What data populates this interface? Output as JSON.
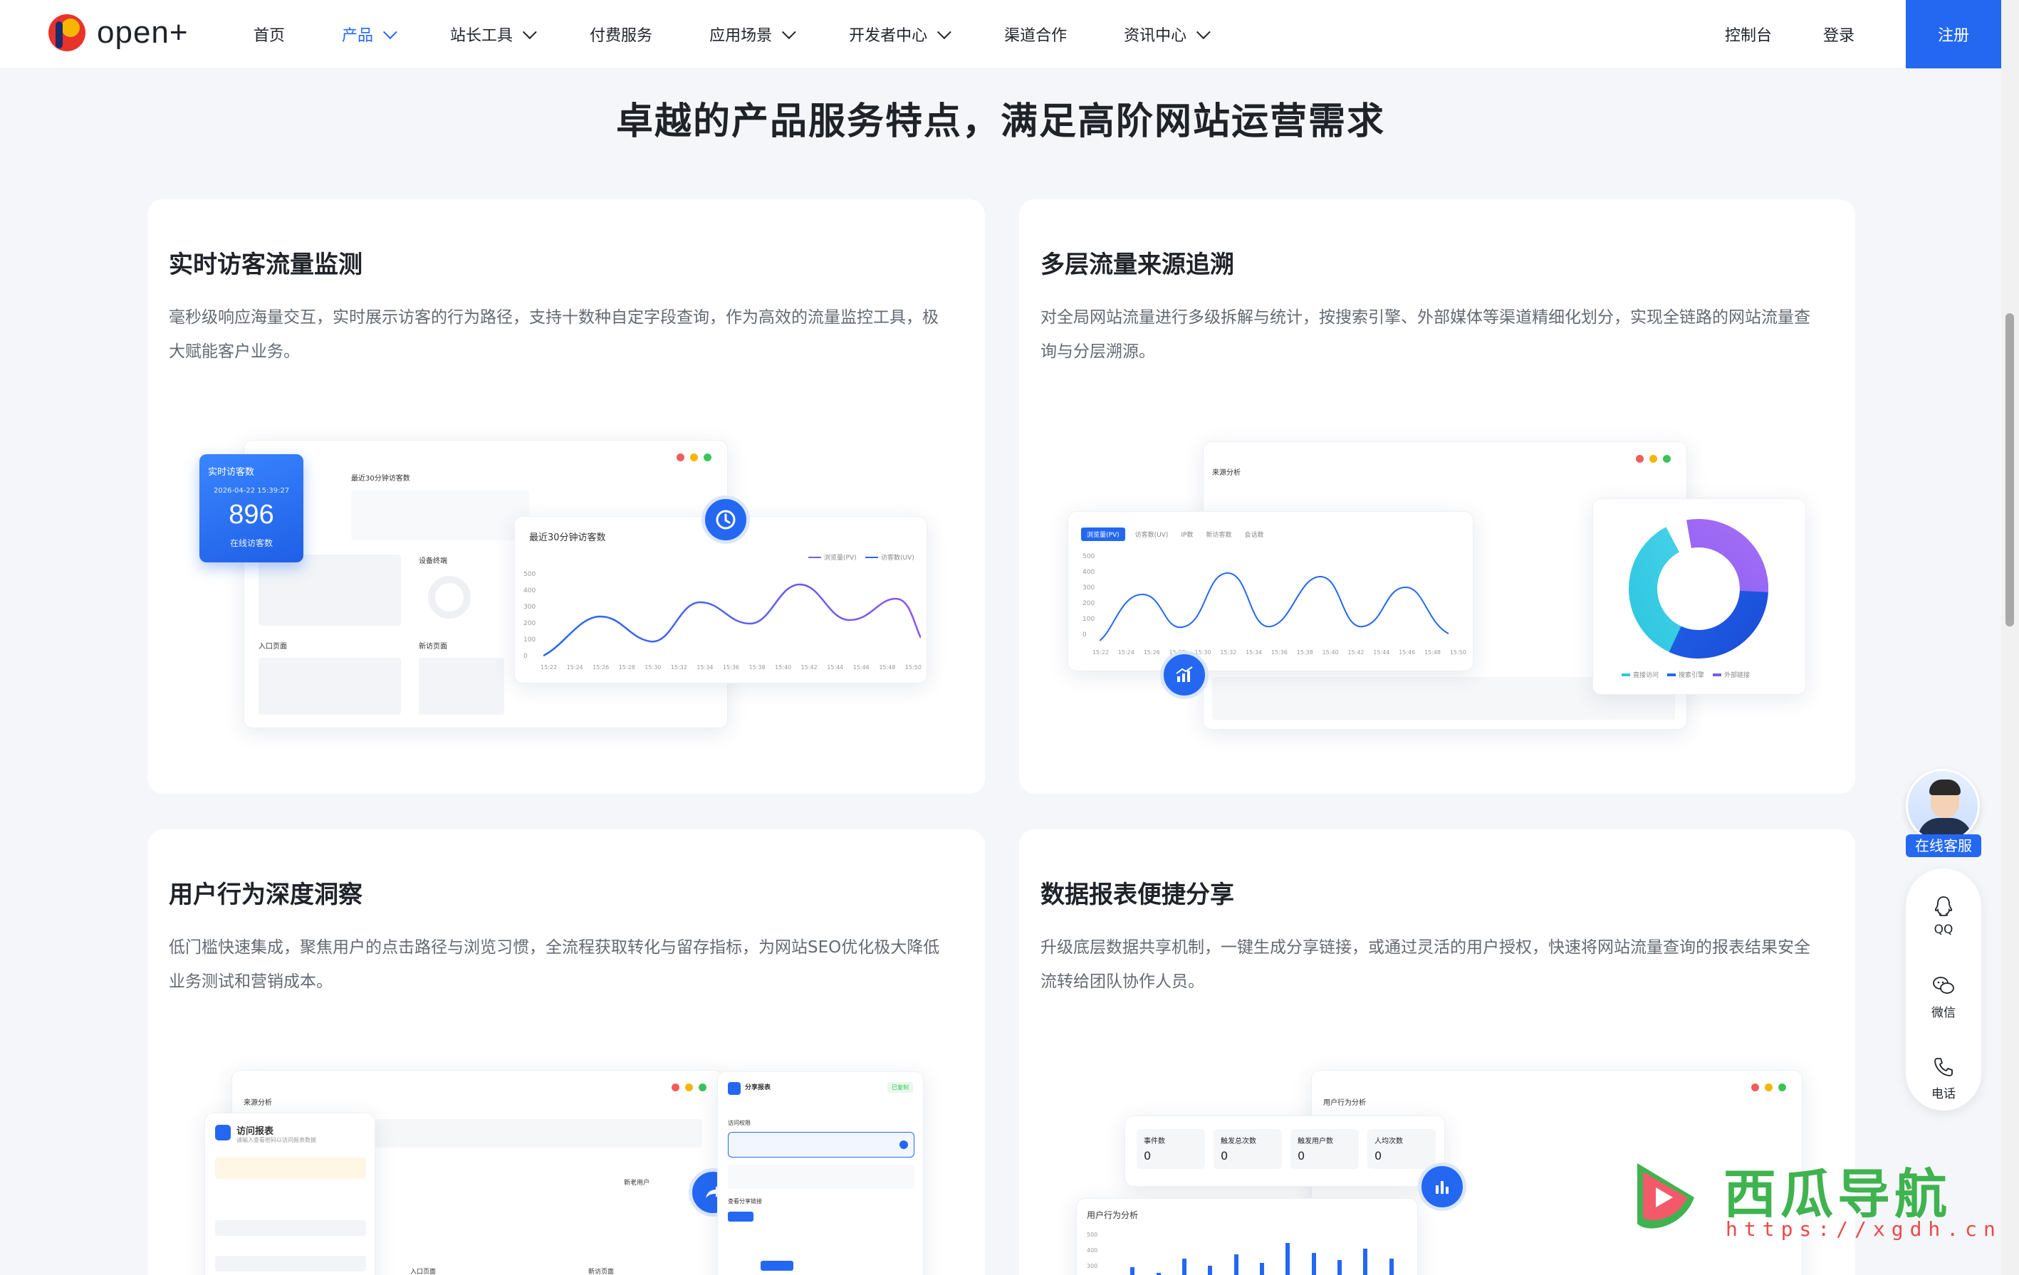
{
  "nav": {
    "brand": "open+",
    "items": [
      {
        "label": "首页",
        "active": false,
        "dropdown": false
      },
      {
        "label": "产品",
        "active": true,
        "dropdown": true
      },
      {
        "label": "站长工具",
        "active": false,
        "dropdown": true
      },
      {
        "label": "付费服务",
        "active": false,
        "dropdown": false
      },
      {
        "label": "应用场景",
        "active": false,
        "dropdown": true
      },
      {
        "label": "开发者中心",
        "active": false,
        "dropdown": true
      },
      {
        "label": "渠道合作",
        "active": false,
        "dropdown": false
      },
      {
        "label": "资讯中心",
        "active": false,
        "dropdown": true
      }
    ],
    "console": "控制台",
    "login": "登录",
    "register": "注册",
    "accent": "#2468f2"
  },
  "section_title": "卓越的产品服务特点，满足高阶网站运营需求",
  "cards": [
    {
      "title": "实时访客流量监测",
      "desc": "毫秒级响应海量交互，实时展示访客的行为路径，支持十数种自定字段查询，作为高效的流量监控工具，极大赋能客户业务。",
      "mock": {
        "realtime_label": "实时访客数",
        "realtime_time": "2026-04-22 15:39:27",
        "realtime_value": "896",
        "realtime_sub": "在线访客数",
        "bg_title": "最近30分钟访客数",
        "device_label": "设备终端",
        "entry_label": "入口页面",
        "new_label": "新访页面",
        "chart_title": "最近30分钟访客数",
        "legend_pv": "浏览量(PV)",
        "legend_uv": "访客数(UV)",
        "y_ticks": [
          "500",
          "400",
          "300",
          "200",
          "100",
          "0"
        ],
        "x_ticks": [
          "15:22",
          "15:24",
          "15:26",
          "15:28",
          "15:30",
          "15:32",
          "15:34",
          "15:36",
          "15:38",
          "15:40",
          "15:42",
          "15:44",
          "15:46",
          "15:48",
          "15:50"
        ]
      }
    },
    {
      "title": "多层流量来源追溯",
      "desc": "对全局网站流量进行多级拆解与统计，按搜索引擎、外部媒体等渠道精细化划分，实现全链路的网站流量查询与分层溯源。",
      "mock": {
        "bg_title": "来源分析",
        "tabs": [
          "浏览量(PV)",
          "访客数(UV)",
          "IP数",
          "新访客数",
          "会话数"
        ],
        "y_ticks": [
          "500",
          "400",
          "300",
          "200",
          "100",
          "0"
        ],
        "x_ticks": [
          "15:22",
          "15:24",
          "15:26",
          "15:28",
          "15:30",
          "15:32",
          "15:34",
          "15:36",
          "15:38",
          "15:40",
          "15:42",
          "15:44",
          "15:46",
          "15:48",
          "15:50"
        ],
        "donut_legend": [
          "直接访问",
          "搜索引擎",
          "外部链接"
        ]
      }
    },
    {
      "title": "用户行为深度洞察",
      "desc": "低门槛快速集成，聚焦用户的点击路径与浏览习惯，全流程获取转化与留存指标，为网站SEO优化极大降低业务测试和营销成本。",
      "mock": {
        "bg_title": "来源分析",
        "report_title": "访问报表",
        "report_sub": "请输入查看密码以访问报表数据",
        "share_title": "分享报表",
        "share_badge": "已复制",
        "access_label": "访问权限",
        "share_link": "查看分享链接",
        "new_user": "新老用户",
        "entry_label": "入口页面",
        "new_page": "新访页面"
      }
    },
    {
      "title": "数据报表便捷分享",
      "desc": "升级底层数据共享机制，一键生成分享链接，或通过灵活的用户授权，快速将网站流量查询的报表结果安全流转给团队协作人员。",
      "mock": {
        "bg_title": "用户行为分析",
        "stats": [
          {
            "label": "事件数",
            "value": "0"
          },
          {
            "label": "触发总次数",
            "value": "0"
          },
          {
            "label": "触发用户数",
            "value": "0"
          },
          {
            "label": "人均次数",
            "value": "0"
          }
        ],
        "chart_title": "用户行为分析",
        "y_ticks": [
          "500",
          "400",
          "300"
        ]
      }
    }
  ],
  "float": {
    "service": "在线客服",
    "qq": "QQ",
    "wechat": "微信",
    "phone": "电话"
  },
  "watermark": {
    "text": "西瓜导航",
    "url": "https://xgdh.cn"
  }
}
